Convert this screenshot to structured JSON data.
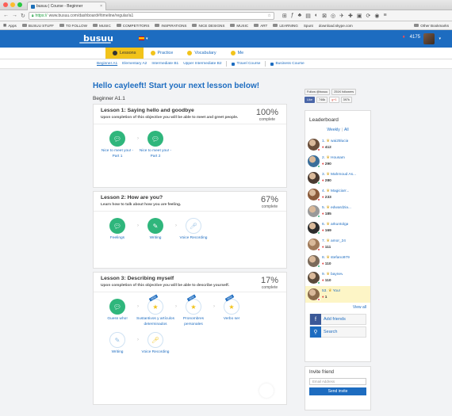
{
  "browser": {
    "tab_title": "busuu | Course - Beginner",
    "url_prefix": "https://",
    "url": "www.busuu.com/dashboard#/timeline/regular/a1",
    "bookmarks": [
      "Apps",
      "BUSUU STUFF",
      "TO FOLLOW",
      "MUSIC",
      "COMPETITORS",
      "INSPIRATIONS",
      "NICE DESIGNS",
      "MUSIC",
      "ART",
      "LEARNING",
      "Spunt",
      "download.skype.com"
    ],
    "other_bookmarks": "Other Bookmarks"
  },
  "site": {
    "logo": "busuu",
    "points": "4175",
    "nav": [
      {
        "label": "Lessons",
        "active": true
      },
      {
        "label": "Practice",
        "active": false
      },
      {
        "label": "Vocabulary",
        "active": false
      },
      {
        "label": "Me",
        "active": false
      }
    ],
    "levels": [
      "Beginner A1",
      "Elementary A2",
      "Intermediate B1",
      "Upper Intermediate B2"
    ],
    "extra_links": [
      "Travel Course",
      "Business Course"
    ]
  },
  "main": {
    "greeting": "Hello cayleeft! Start your next lesson below!",
    "level_title": "Beginner A1.1",
    "lessons": [
      {
        "title": "Lesson 1: Saying hello and goodbye",
        "desc": "Upon completion of this objective you will be able to meet and greet people.",
        "percent": "100%",
        "percent_label": "complete",
        "activities": [
          {
            "label": "Nice to meet you! - Part 1",
            "state": "done"
          },
          {
            "label": "Nice to meet you! - Part 2",
            "state": "done"
          }
        ]
      },
      {
        "title": "Lesson 2: How are you?",
        "desc": "Learn how to talk about how you are feeling.",
        "percent": "67%",
        "percent_label": "complete",
        "activities": [
          {
            "label": "Feelings",
            "state": "done"
          },
          {
            "label": "Writing",
            "state": "done"
          },
          {
            "label": "Voice Recording",
            "state": "todo"
          }
        ]
      },
      {
        "title": "Lesson 3: Describing myself",
        "desc": "Upon completion of this objective you will be able to describe yourself.",
        "percent": "17%",
        "percent_label": "complete",
        "activities": [
          {
            "label": "Guess who!",
            "state": "done"
          },
          {
            "label": "Sustantivos y artículos determinados",
            "state": "todo"
          },
          {
            "label": "Pronombres personales",
            "state": "todo"
          },
          {
            "label": "Verbo ser",
            "state": "todo"
          },
          {
            "label": "Writing",
            "state": "todo"
          },
          {
            "label": "Voice Recording",
            "state": "todo"
          }
        ]
      }
    ]
  },
  "sidebar": {
    "follow": "Follow @busuu",
    "followers": "251K followers",
    "like": "Like",
    "like_count": "746k",
    "gplus_count": "397k",
    "leaderboard_title": "Leaderboard",
    "filter_weekly": "Weekly",
    "filter_all": "All",
    "leaders": [
      {
        "rank": "1.",
        "name": "wai25lucia",
        "points": "412",
        "color": "#6a4e3a"
      },
      {
        "rank": "2.",
        "name": "Housam",
        "points": "290",
        "color": "#3a6e9a"
      },
      {
        "rank": "3.",
        "name": "Mahmoud As...",
        "points": "280",
        "color": "#4a3a30"
      },
      {
        "rank": "4.",
        "name": "Magiciarr...",
        "points": "233",
        "color": "#8a5a3a"
      },
      {
        "rank": "5.",
        "name": "edwardzia...",
        "points": "185",
        "color": "#999999"
      },
      {
        "rank": "6.",
        "name": "arkuntolga",
        "points": "169",
        "color": "#2d2d2d"
      },
      {
        "rank": "7.",
        "name": "amor_24",
        "points": "111",
        "color": "#a07a5a"
      },
      {
        "rank": "8.",
        "name": "stefano979",
        "points": "110",
        "color": "#7a6a5a"
      },
      {
        "rank": "9.",
        "name": "baynev",
        "points": "110",
        "color": "#5a4a3a"
      },
      {
        "rank": "53.",
        "name": "You!",
        "points": "1",
        "color": "#8a6a4a"
      }
    ],
    "view_all": "View all",
    "add_friends": "Add friends",
    "search": "Search",
    "invite_title": "Invite friend",
    "email_placeholder": "Email Address",
    "send_invite": "Send invite"
  }
}
